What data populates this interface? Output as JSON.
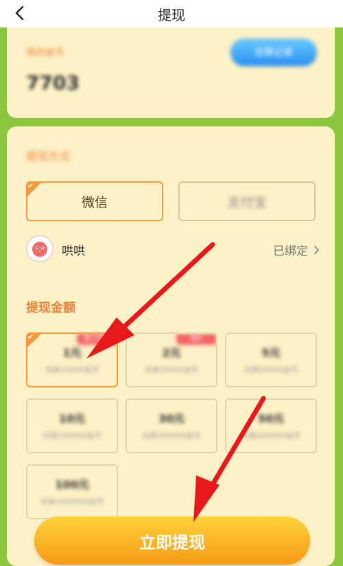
{
  "header": {
    "title": "提现"
  },
  "coins": {
    "label": "我的金币",
    "value": "7703",
    "record_button": "兑换记录"
  },
  "method": {
    "title": "提现方式",
    "options": [
      "微信",
      "支付宝"
    ]
  },
  "account": {
    "name": "哄哄",
    "status": "已绑定"
  },
  "amount": {
    "title": "提现金额",
    "options": [
      {
        "amount": "1元",
        "sub": "兑换10000金币",
        "badge": "新人专享"
      },
      {
        "amount": "2元",
        "sub": "兑换20000金币",
        "badge": "限时"
      },
      {
        "amount": "5元",
        "sub": "兑换50000金币",
        "badge": ""
      },
      {
        "amount": "10元",
        "sub": "兑换100000金币",
        "badge": ""
      },
      {
        "amount": "30元",
        "sub": "兑换300000金币",
        "badge": ""
      },
      {
        "amount": "50元",
        "sub": "兑换500000金币",
        "badge": ""
      },
      {
        "amount": "100元",
        "sub": "兑换1000000金币",
        "badge": ""
      }
    ]
  },
  "action": {
    "withdraw_button": "立即提现"
  },
  "colors": {
    "accent": "#f39a3a",
    "background": "#8cc63f",
    "card": "#fdf1c7",
    "annotation": "#e8181b"
  }
}
